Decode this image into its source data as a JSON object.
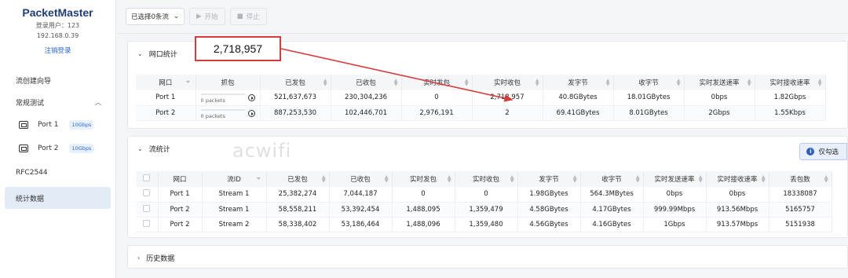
{
  "sidebar": {
    "brand": "PacketMaster",
    "user": "登录用户：123",
    "ip": "192.168.0.39",
    "logout": "注销登录",
    "items": [
      {
        "label": "流创建向导"
      },
      {
        "label": "常规测试"
      },
      {
        "label": "Port 1",
        "speed": "10Gbps"
      },
      {
        "label": "Port 2",
        "speed": "10Gbps"
      },
      {
        "label": "RFC2544"
      },
      {
        "label": "统计数据"
      }
    ]
  },
  "toolbar": {
    "selector": "已选择0条流",
    "start": "开始",
    "stop": "停止"
  },
  "callout": {
    "value": "2,718,957"
  },
  "port_stats": {
    "title": "网口统计",
    "columns": [
      "网口",
      "抓包",
      "已发包",
      "已收包",
      "实时发包",
      "实时收包",
      "发字节",
      "收字节",
      "实时发送速率",
      "实时接收速率"
    ],
    "rows": [
      [
        "Port 1",
        "0 packets",
        "521,637,673",
        "230,304,236",
        "0",
        "2,718,957",
        "40.8GBytes",
        "18.01GBytes",
        "0bps",
        "1.82Gbps"
      ],
      [
        "Port 2",
        "0 packets",
        "887,253,530",
        "102,446,701",
        "2,976,191",
        "2",
        "69.41GBytes",
        "8.01GBytes",
        "2Gbps",
        "1.55Kbps"
      ]
    ]
  },
  "flow_stats": {
    "title": "流统计",
    "chip": "仅勾选",
    "columns": [
      "网口",
      "流ID",
      "已发包",
      "已收包",
      "实时发包",
      "实时收包",
      "发字节",
      "收字节",
      "实时发送速率",
      "实时接收速率",
      "丢包数"
    ],
    "rows": [
      [
        "Port 1",
        "Stream 1",
        "25,382,274",
        "7,044,187",
        "0",
        "0",
        "1.98GBytes",
        "564.3MBytes",
        "0bps",
        "0bps",
        "18338087"
      ],
      [
        "Port 2",
        "Stream 1",
        "58,558,211",
        "53,392,454",
        "1,488,095",
        "1,359,479",
        "4.58GBytes",
        "4.17GBytes",
        "999.99Mbps",
        "913.56Mbps",
        "5165757"
      ],
      [
        "Port 2",
        "Stream 2",
        "58,338,402",
        "53,186,464",
        "1,488,096",
        "1,359,480",
        "4.56GBytes",
        "4.16GBytes",
        "1Gbps",
        "913.57Mbps",
        "5151938"
      ]
    ]
  },
  "history": {
    "title": "历史数据"
  },
  "watermark": "acwifi",
  "colors": {
    "brand": "#1f3d7a",
    "accent": "#2a6ad6",
    "callout": "#d93a3a"
  }
}
